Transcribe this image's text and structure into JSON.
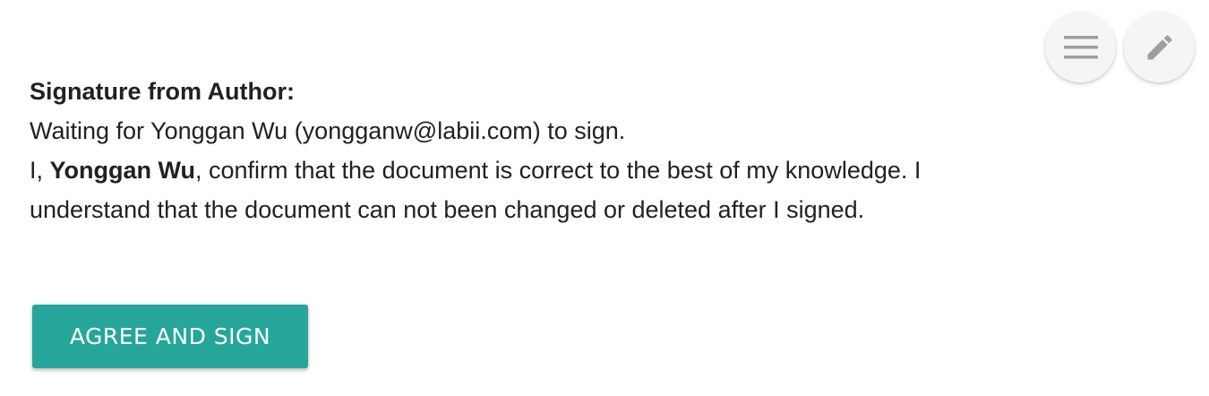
{
  "toolbar": {
    "menu_icon": "menu-icon",
    "edit_icon": "edit-pencil-icon"
  },
  "signature": {
    "heading": "Signature from Author:",
    "waiting_text": "Waiting for Yonggan Wu (yongganw@labii.com) to sign.",
    "confirm_prefix": "I, ",
    "signer_name": "Yonggan Wu",
    "confirm_suffix": ", confirm that the document is correct to the best of my knowledge. I understand that the document can not been changed or deleted after I signed.",
    "button_label": "AGREE AND SIGN"
  },
  "colors": {
    "button": "#26a69a",
    "fab_background": "#f5f5f5",
    "icon": "#9e9e9e"
  }
}
